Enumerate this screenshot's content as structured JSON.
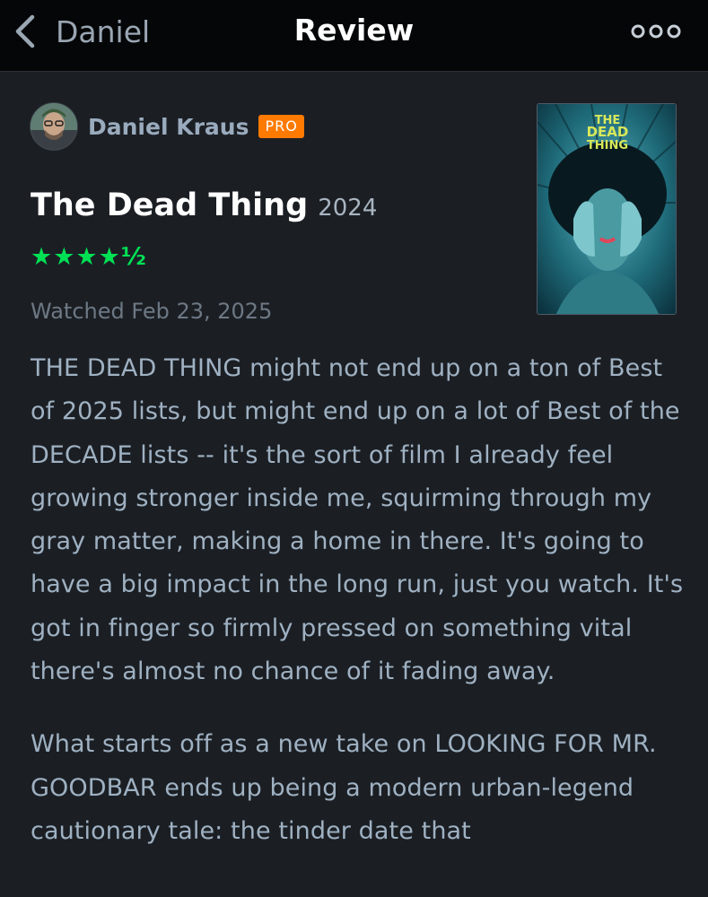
{
  "header": {
    "back_label": "Daniel",
    "title": "Review"
  },
  "author": {
    "name": "Daniel Kraus",
    "badge": "PRO"
  },
  "film": {
    "title": "The Dead Thing",
    "year": "2024",
    "rating_display": "★★★★½",
    "rating_value": 4.5,
    "rating_max": 5,
    "watched": "Watched Feb 23, 2025",
    "poster_text": [
      "THE",
      "DEAD",
      "THING"
    ]
  },
  "review": {
    "paragraphs": [
      "THE DEAD THING might not end up on a ton of Best of 2025 lists, but might end up on a lot of Best of the DECADE lists -- it's the sort of film I already feel growing stronger inside me, squirming through my gray matter, making a home in there. It's going to have a big impact in the long run, just you watch. It's got in finger so firmly pressed on something vital there's almost no chance of it fading away.",
      "What starts off as a new take on LOOKING FOR MR. GOODBAR ends up being a modern urban-legend cautionary tale: the tinder date that"
    ]
  },
  "colors": {
    "accent_green": "#00e054",
    "pro_orange": "#ff7a00",
    "background": "#1b1f24",
    "topbar": "#050607",
    "body_text": "#9fb1c2"
  },
  "icons": {
    "back": "chevron-left-icon",
    "more": "more-horizontal-icon"
  }
}
